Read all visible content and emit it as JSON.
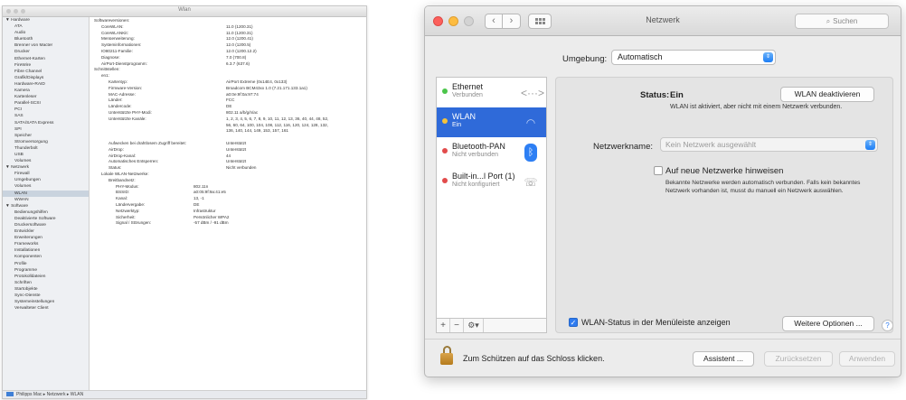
{
  "sysinfo": {
    "window_title": "Wlan",
    "sidebar": [
      {
        "label": "▼ Hardware",
        "header": true
      },
      {
        "label": "ATA"
      },
      {
        "label": "Audio"
      },
      {
        "label": "Bluetooth"
      },
      {
        "label": "Brenner von Macter"
      },
      {
        "label": "Drucker"
      },
      {
        "label": "Ethernet-Karten"
      },
      {
        "label": "FireWire"
      },
      {
        "label": "Fibre Channel"
      },
      {
        "label": "Grafik/Displays"
      },
      {
        "label": "Hardware-RAID"
      },
      {
        "label": "Kamera"
      },
      {
        "label": "Kartenleser"
      },
      {
        "label": "Parallel-SCSI"
      },
      {
        "label": "PCI"
      },
      {
        "label": "SAS"
      },
      {
        "label": "SATA/SATA Express"
      },
      {
        "label": "SPI"
      },
      {
        "label": "Speicher"
      },
      {
        "label": "Stromversorgung"
      },
      {
        "label": "Thunderbolt"
      },
      {
        "label": "USB"
      },
      {
        "label": "Volumes"
      },
      {
        "label": "▼ Netzwerk",
        "header": true
      },
      {
        "label": "Firewall"
      },
      {
        "label": "Umgebungen"
      },
      {
        "label": "Volumes"
      },
      {
        "label": "WLAN",
        "selected": true
      },
      {
        "label": "WWAN"
      },
      {
        "label": "▼ Software",
        "header": true
      },
      {
        "label": "Bedienungshilfen"
      },
      {
        "label": "Deaktivierte Software"
      },
      {
        "label": "Druckersoftware"
      },
      {
        "label": "Entwickler"
      },
      {
        "label": "Erweiterungen"
      },
      {
        "label": "Frameworks"
      },
      {
        "label": "Installationen"
      },
      {
        "label": "Komponenten"
      },
      {
        "label": "Profile"
      },
      {
        "label": "Programme"
      },
      {
        "label": "Protokolldateien"
      },
      {
        "label": "Schriften"
      },
      {
        "label": "Startobjekte"
      },
      {
        "label": "Sync-Dienste"
      },
      {
        "label": "Systemeinstellungen"
      },
      {
        "label": "Verwalteter Client"
      }
    ],
    "rows": [
      {
        "k": "Softwareversionen:",
        "v": "",
        "i": 0
      },
      {
        "k": "CoreWLAN:",
        "v": "11.0 (1200.31)",
        "i": 1
      },
      {
        "k": "CoreWLANKit:",
        "v": "11.0 (1200.31)",
        "i": 1
      },
      {
        "k": "Menüerweiterung:",
        "v": "12.0 (1200.41)",
        "i": 1
      },
      {
        "k": "Systeminformationen:",
        "v": "12.0 (1200.5)",
        "i": 1
      },
      {
        "k": "IO80211-Familie:",
        "v": "12.0 (1200.12.2)",
        "i": 1
      },
      {
        "k": "Diagnose:",
        "v": "7.0 (700.8)",
        "i": 1
      },
      {
        "k": "AirPort-Dienstprogramm:",
        "v": "6.3.7 (637.6)",
        "i": 1
      },
      {
        "k": "Schnittstellen:",
        "v": "",
        "i": 0
      },
      {
        "k": "en1:",
        "v": "",
        "i": 1
      },
      {
        "k": "Kartentyp:",
        "v": "AirPort Extreme (0x14E4, 0x133)",
        "i": 2
      },
      {
        "k": "Firmware-Version:",
        "v": "Broadcom BCM43xx 1.0 (7.21.171.133.1a1)",
        "i": 2
      },
      {
        "k": "MAC-Adresse:",
        "v": "a0:0e:9f:0a:97:74",
        "i": 2
      },
      {
        "k": "Länder:",
        "v": "FCC",
        "i": 2
      },
      {
        "k": "Ländercode:",
        "v": "DE",
        "i": 2
      },
      {
        "k": "Unterstützte PHY-Modi:",
        "v": "802.11 a/b/g/n/ac",
        "i": 2
      },
      {
        "k": "Unterstützte Kanäle:",
        "v": "1, 2, 3, 4, 5, 6, 7, 8, 9, 10, 11, 12, 13, 36, 40, 44, 48, 52,",
        "i": 2
      },
      {
        "k": "",
        "v": "56, 60, 64, 100, 104, 108, 112, 116, 120, 124, 128, 132,",
        "i": 2
      },
      {
        "k": "",
        "v": "136, 140, 144, 149, 153, 157, 161",
        "i": 2
      },
      {
        "k": "",
        "v": "",
        "i": 0
      },
      {
        "k": "Aufwecken bei drahtlosem Zugriff bereitet:",
        "v": "Unterstützt",
        "i": 2
      },
      {
        "k": "AirDrop:",
        "v": "Unterstützt",
        "i": 2
      },
      {
        "k": "AirDrop-Kanal:",
        "v": "44",
        "i": 2
      },
      {
        "k": "Automatisches Entsperren:",
        "v": "Unterstützt",
        "i": 2
      },
      {
        "k": "Status:",
        "v": "Nicht verbunden",
        "i": 2
      },
      {
        "k": "Lokale WLAN-Netzwerke:",
        "v": "",
        "i": 1
      },
      {
        "k": "Breitbandnetz:",
        "v": "",
        "i": 2
      },
      {
        "k": "PHY-Modus:",
        "v": "802.11n",
        "i": 3
      },
      {
        "k": "BSSID:",
        "v": "a0:05:9f:9a:41:e5",
        "i": 3
      },
      {
        "k": "Kanal:",
        "v": "13, -1",
        "i": 3
      },
      {
        "k": "Ländervergabe:",
        "v": "DE",
        "i": 3
      },
      {
        "k": "Netzwerktyp:",
        "v": "Infrastruktur",
        "i": 3
      },
      {
        "k": "Sicherheit:",
        "v": "Persönlicher WPA2",
        "i": 3
      },
      {
        "k": "Signal / Störungen:",
        "v": "-57 dBm / -91 dBm",
        "i": 3
      }
    ],
    "path": "Philipps Mac ▸ Netzwerk ▸ WLAN"
  },
  "net": {
    "window_title": "Netzwerk",
    "search_placeholder": "Suchen",
    "location_label": "Umgebung:",
    "location_value": "Automatisch",
    "services": [
      {
        "name": "Ethernet",
        "status": "Verbunden",
        "dot": "green",
        "icon": "<···>"
      },
      {
        "name": "WLAN",
        "status": "Ein",
        "dot": "yellow",
        "icon": "◠",
        "selected": true
      },
      {
        "name": "Bluetooth-PAN",
        "status": "Nicht verbunden",
        "dot": "red",
        "icon": "ᛒ"
      },
      {
        "name": "Built-in...l Port (1)",
        "status": "Nicht konfiguriert",
        "dot": "red",
        "icon": "☏"
      }
    ],
    "tools": {
      "add": "+",
      "remove": "−",
      "gear": "⚙▾"
    },
    "status_label": "Status:",
    "status_value": "Ein",
    "status_button": "WLAN deaktivieren",
    "status_desc": "WLAN ist aktiviert, aber nicht mit einem Netzwerk verbunden.",
    "netname_label": "Netzwerkname:",
    "netname_placeholder": "Kein Netzwerk ausgewählt",
    "ask_label": "Auf neue Netzwerke hinweisen",
    "ask_desc": "Bekannte Netzwerke werden automatisch verbunden. Falls kein bekanntes Netzwerk vorhanden ist, musst du manuell ein Netzwerk auswählen.",
    "menubar_label": "WLAN-Status in der Menüleiste anzeigen",
    "advanced_button": "Weitere Optionen ...",
    "help": "?",
    "lock_label": "Zum Schützen auf das Schloss klicken.",
    "assistant_button": "Assistent ...",
    "revert_button": "Zurücksetzen",
    "apply_button": "Anwenden"
  }
}
